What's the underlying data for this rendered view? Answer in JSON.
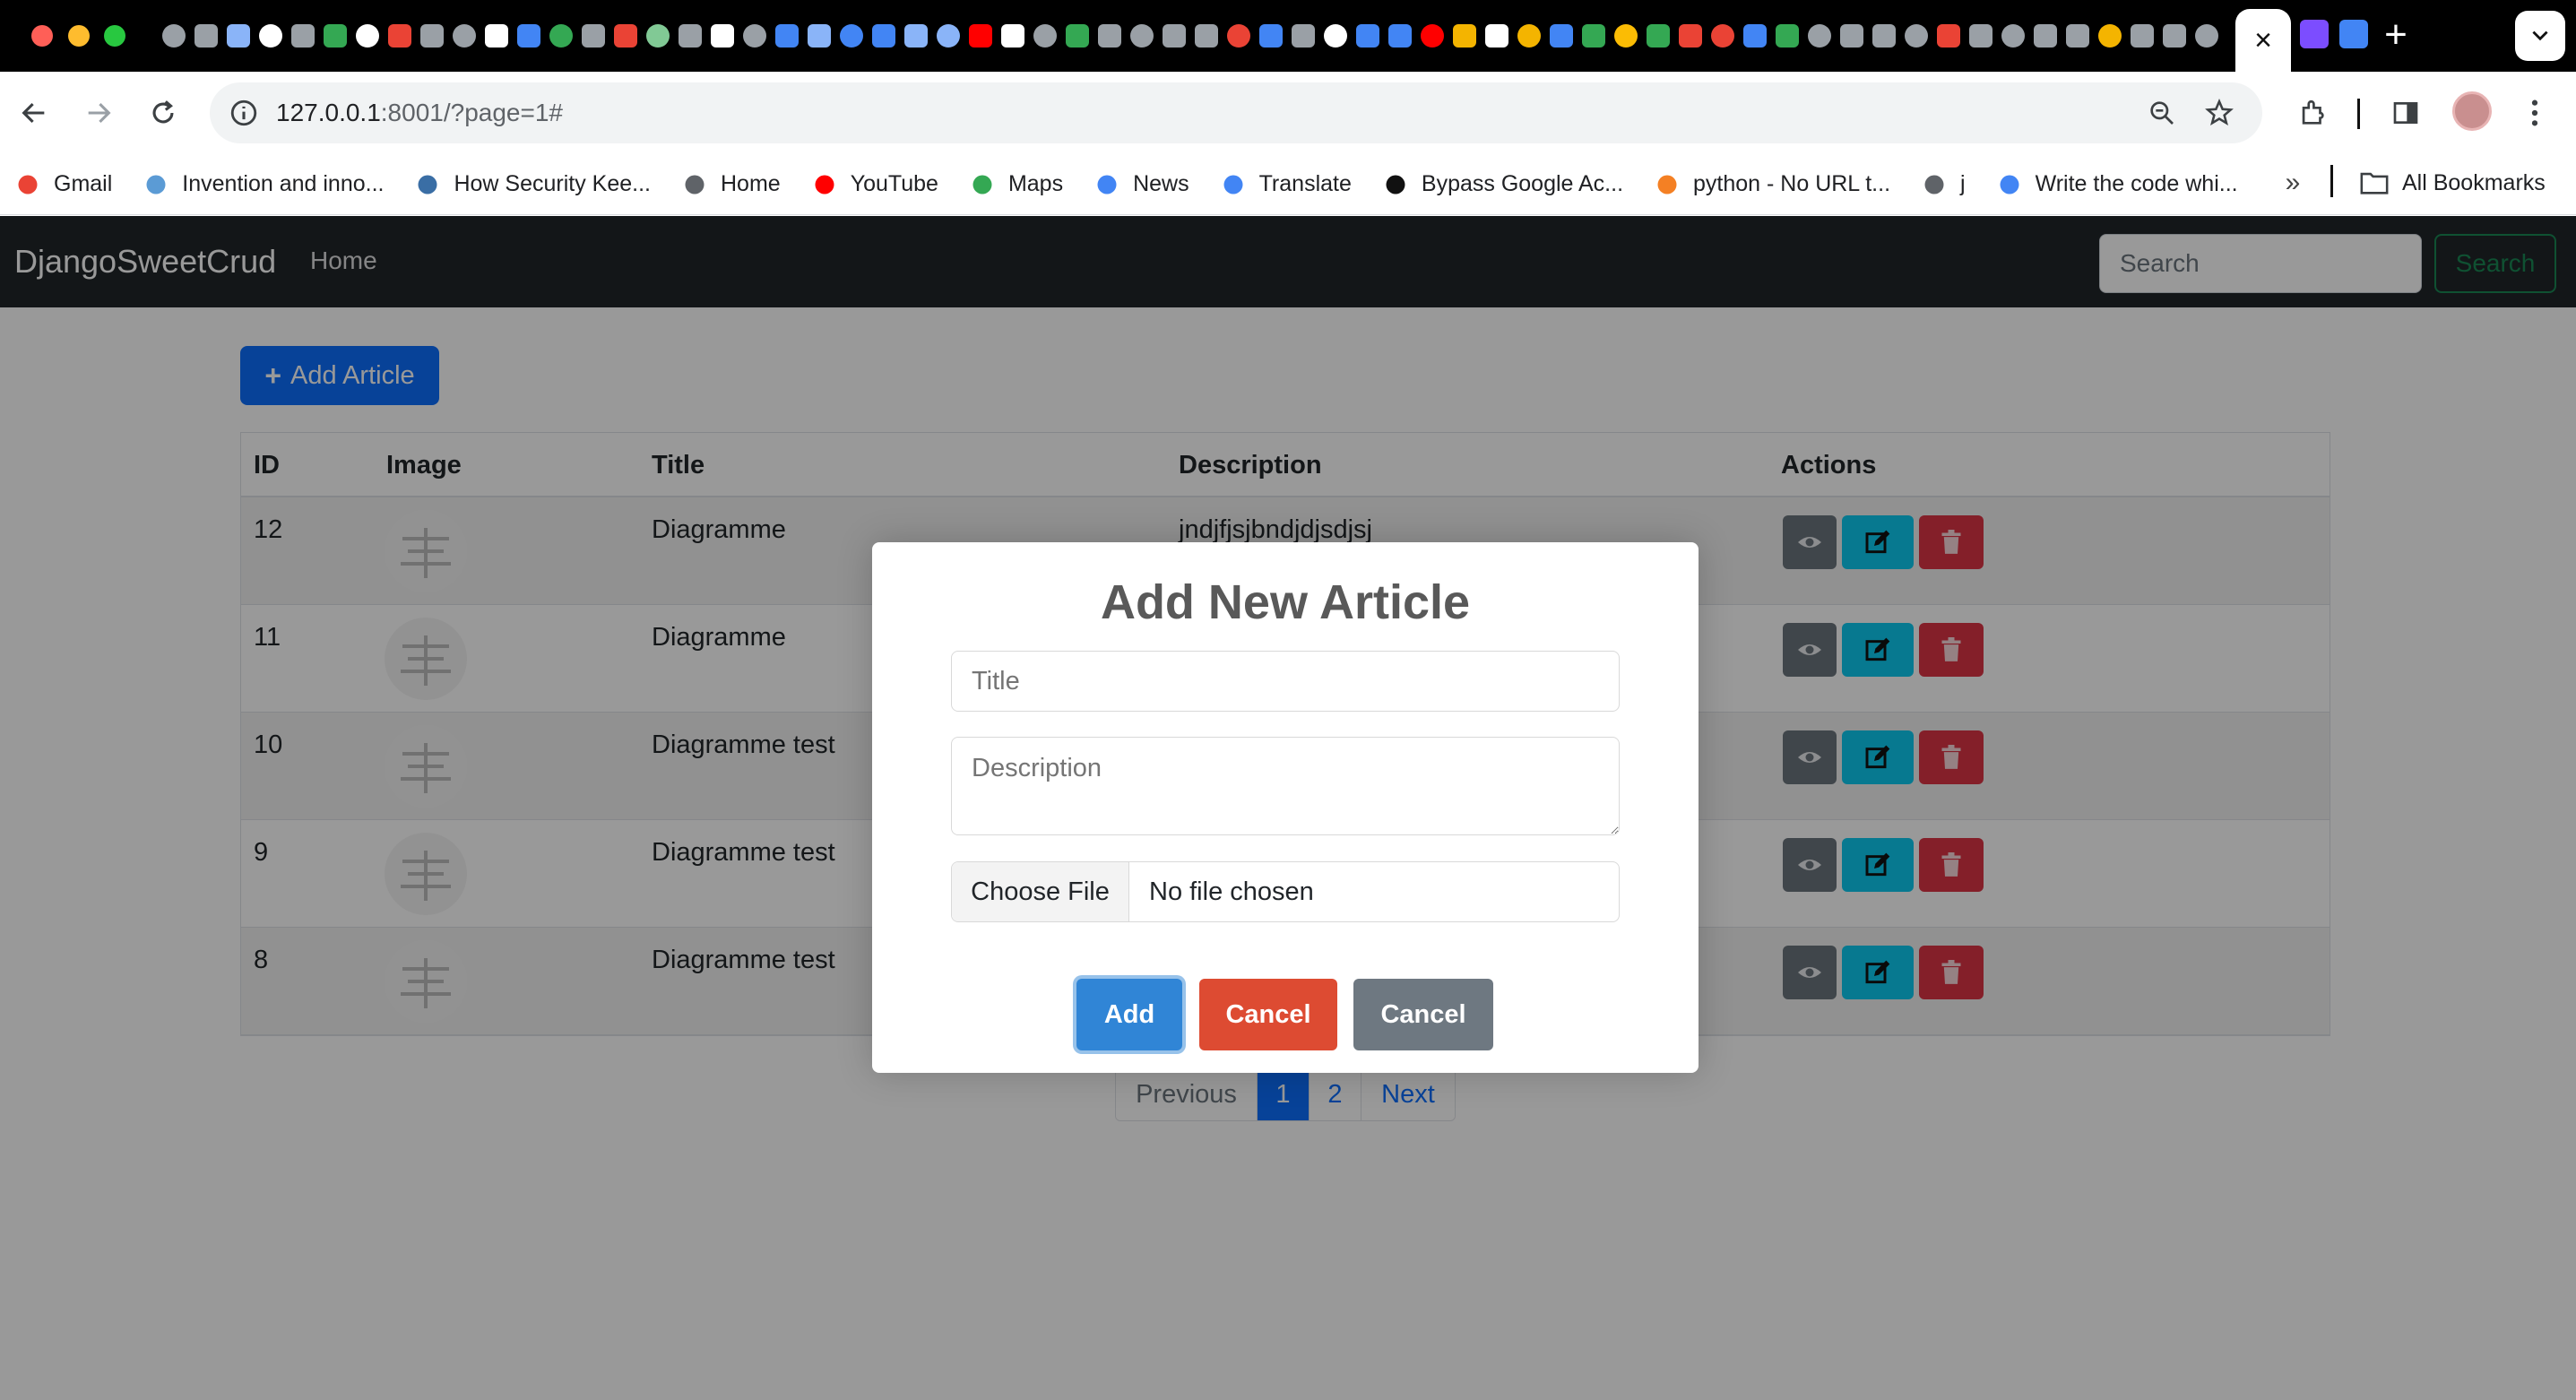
{
  "browser": {
    "tab_close_symbol": "×",
    "new_tab_symbol": "+",
    "tab_menu_symbol": "⌄",
    "tab_icon_colors": [
      "#9aa0a6",
      "#9aa0a6",
      "#8ab4f8",
      "#ffffff",
      "#9aa0a6",
      "#34a853",
      "#ffffff",
      "#ea4335",
      "#9aa0a6",
      "#9aa0a6",
      "#ffffff",
      "#4285f4",
      "#34a853",
      "#9aa0a6",
      "#ea4335",
      "#81c995",
      "#9aa0a6",
      "#ffffff",
      "#9aa0a6",
      "#4285f4",
      "#8ab4f8",
      "#4285f4",
      "#4285f4",
      "#8ab4f8",
      "#8ab4f8",
      "#ff0000",
      "#ffffff",
      "#9aa0a6",
      "#34a853",
      "#9aa0a6",
      "#9aa0a6",
      "#9aa0a6",
      "#9aa0a6",
      "#ea4335",
      "#4285f4",
      "#9aa0a6",
      "#ffffff",
      "#4285f4",
      "#4285f4",
      "#ff0000",
      "#f4b400",
      "#ffffff",
      "#f4b400",
      "#4285f4",
      "#34a853",
      "#fbbc04",
      "#34a853",
      "#ea4335",
      "#ea4335",
      "#4285f4",
      "#34a853",
      "#9aa0a6",
      "#9aa0a6",
      "#9aa0a6",
      "#9aa0a6",
      "#ea4335",
      "#9aa0a6",
      "#9aa0a6",
      "#9aa0a6",
      "#9aa0a6",
      "#f4b400",
      "#9aa0a6",
      "#9aa0a6",
      "#9aa0a6"
    ],
    "after_tab_icon_colors": [
      "#7c4dff",
      "#4285f4"
    ],
    "url_host": "127.0.0.1",
    "url_rest": ":8001/?page=1#"
  },
  "bookmarks": [
    {
      "label": "Gmail",
      "icon": "gmail-icon",
      "color": "#ea4335"
    },
    {
      "label": "Invention and inno...",
      "icon": "shield-icon",
      "color": "#5b9bd5"
    },
    {
      "label": "How Security Kee...",
      "icon": "cube-icon",
      "color": "#3a6ea5"
    },
    {
      "label": "Home",
      "icon": "globe-icon",
      "color": "#5f6368"
    },
    {
      "label": "YouTube",
      "icon": "youtube-icon",
      "color": "#ff0000"
    },
    {
      "label": "Maps",
      "icon": "maps-pin-icon",
      "color": "#34a853"
    },
    {
      "label": "News",
      "icon": "google-news-icon",
      "color": "#4285f4"
    },
    {
      "label": "Translate",
      "icon": "translate-icon",
      "color": "#4285f4"
    },
    {
      "label": "Bypass Google Ac...",
      "icon": "bypass-icon",
      "color": "#111111"
    },
    {
      "label": "python - No URL t...",
      "icon": "stackoverflow-icon",
      "color": "#f48024"
    },
    {
      "label": "j",
      "icon": "globe-icon",
      "color": "#5f6368"
    },
    {
      "label": "Write the code whi...",
      "icon": "google-icon",
      "color": "#4285f4"
    }
  ],
  "bookmarks_more": "»",
  "all_bookmarks": "All Bookmarks",
  "navbar": {
    "brand": "DjangoSweetCrud",
    "home": "Home",
    "search_placeholder": "Search",
    "search_button": "Search"
  },
  "add_article_button": "Add Article",
  "table": {
    "headers": [
      "ID",
      "Image",
      "Title",
      "Description",
      "Actions"
    ],
    "rows": [
      {
        "id": "12",
        "title": "Diagramme",
        "description": "jndjfjsjbndjdjsdjsj"
      },
      {
        "id": "11",
        "title": "Diagramme",
        "description": ""
      },
      {
        "id": "10",
        "title": "Diagramme test",
        "description": ""
      },
      {
        "id": "9",
        "title": "Diagramme test",
        "description": ""
      },
      {
        "id": "8",
        "title": "Diagramme test",
        "description": ""
      }
    ]
  },
  "pagination": {
    "previous": "Previous",
    "current": "1",
    "page2": "2",
    "next": "Next"
  },
  "modal": {
    "title": "Add New Article",
    "title_placeholder": "Title",
    "description_placeholder": "Description",
    "file_button": "Choose File",
    "file_status": "No file chosen",
    "add": "Add",
    "cancel_1": "Cancel",
    "cancel_2": "Cancel"
  },
  "colors": {
    "primary": "#0d6efd",
    "navbar": "#212529",
    "success": "#198754",
    "view": "#6c757d",
    "edit": "#0dcaf0",
    "delete": "#dc3545",
    "swal_confirm": "#3085d6",
    "swal_cancel_red": "#dd4b32",
    "swal_cancel_gray": "#6e7881"
  }
}
